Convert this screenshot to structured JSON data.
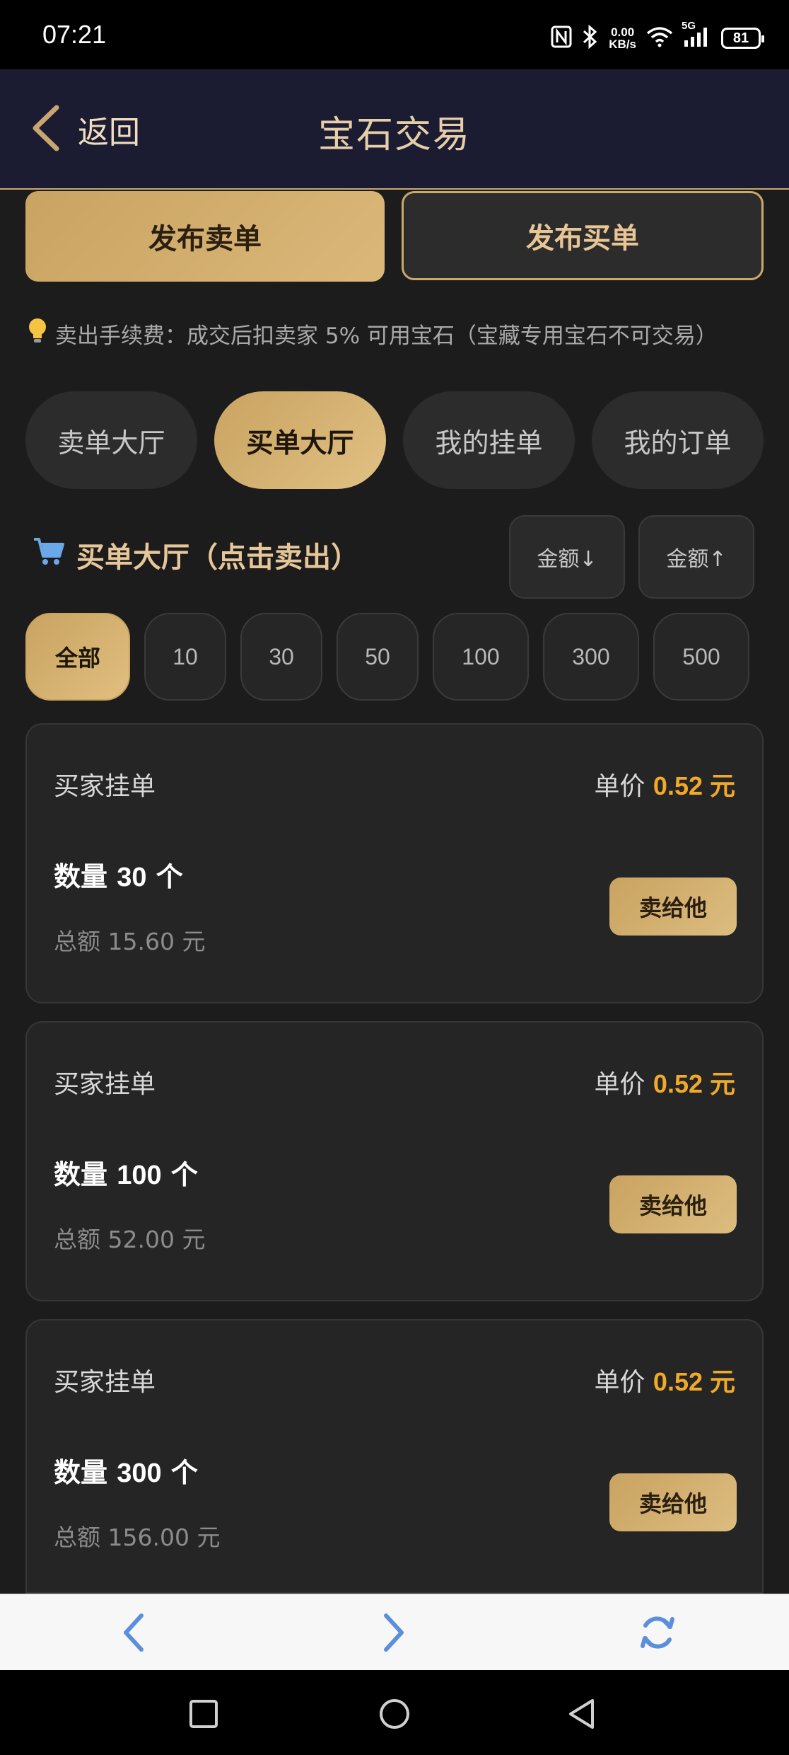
{
  "status_bar": {
    "time": "07:21",
    "net_speed_value": "0.00",
    "net_speed_unit": "KB/s",
    "network_label": "5G",
    "battery": "81"
  },
  "nav": {
    "back_label": "返回",
    "title": "宝石交易"
  },
  "actions": {
    "post_sell": "发布卖单",
    "post_buy": "发布买单"
  },
  "notice": "卖出手续费：成交后扣卖家 5% 可用宝石（宝藏专用宝石不可交易）",
  "tabs": [
    {
      "label": "卖单大厅",
      "active": false
    },
    {
      "label": "买单大厅",
      "active": true
    },
    {
      "label": "我的挂单",
      "active": false
    },
    {
      "label": "我的订单",
      "active": false
    }
  ],
  "section": {
    "title": "买单大厅（点击卖出）",
    "sort_desc": "金额↓",
    "sort_asc": "金额↑"
  },
  "filters": [
    "全部",
    "10",
    "30",
    "50",
    "100",
    "300",
    "500"
  ],
  "active_filter": "全部",
  "orders": [
    {
      "type": "买家挂单",
      "price_label": "单价",
      "price": "0.52 元",
      "qty_label": "数量",
      "qty": "30",
      "qty_unit": "个",
      "total": "总额 15.60 元",
      "action": "卖给他"
    },
    {
      "type": "买家挂单",
      "price_label": "单价",
      "price": "0.52 元",
      "qty_label": "数量",
      "qty": "100",
      "qty_unit": "个",
      "total": "总额 52.00 元",
      "action": "卖给他"
    },
    {
      "type": "买家挂单",
      "price_label": "单价",
      "price": "0.52 元",
      "qty_label": "数量",
      "qty": "300",
      "qty_unit": "个",
      "total": "总额 156.00 元",
      "action": "卖给他"
    }
  ],
  "browser_controls": [
    "chevron-left-icon",
    "chevron-right-icon",
    "refresh-icon"
  ],
  "system_nav": [
    "square-icon",
    "circle-icon",
    "triangle-back-icon"
  ],
  "colors": {
    "accent_gold": "#c9a361",
    "price_orange": "#f0a928",
    "header_bg": "#1b1c32",
    "page_bg": "#1c1c1c"
  }
}
